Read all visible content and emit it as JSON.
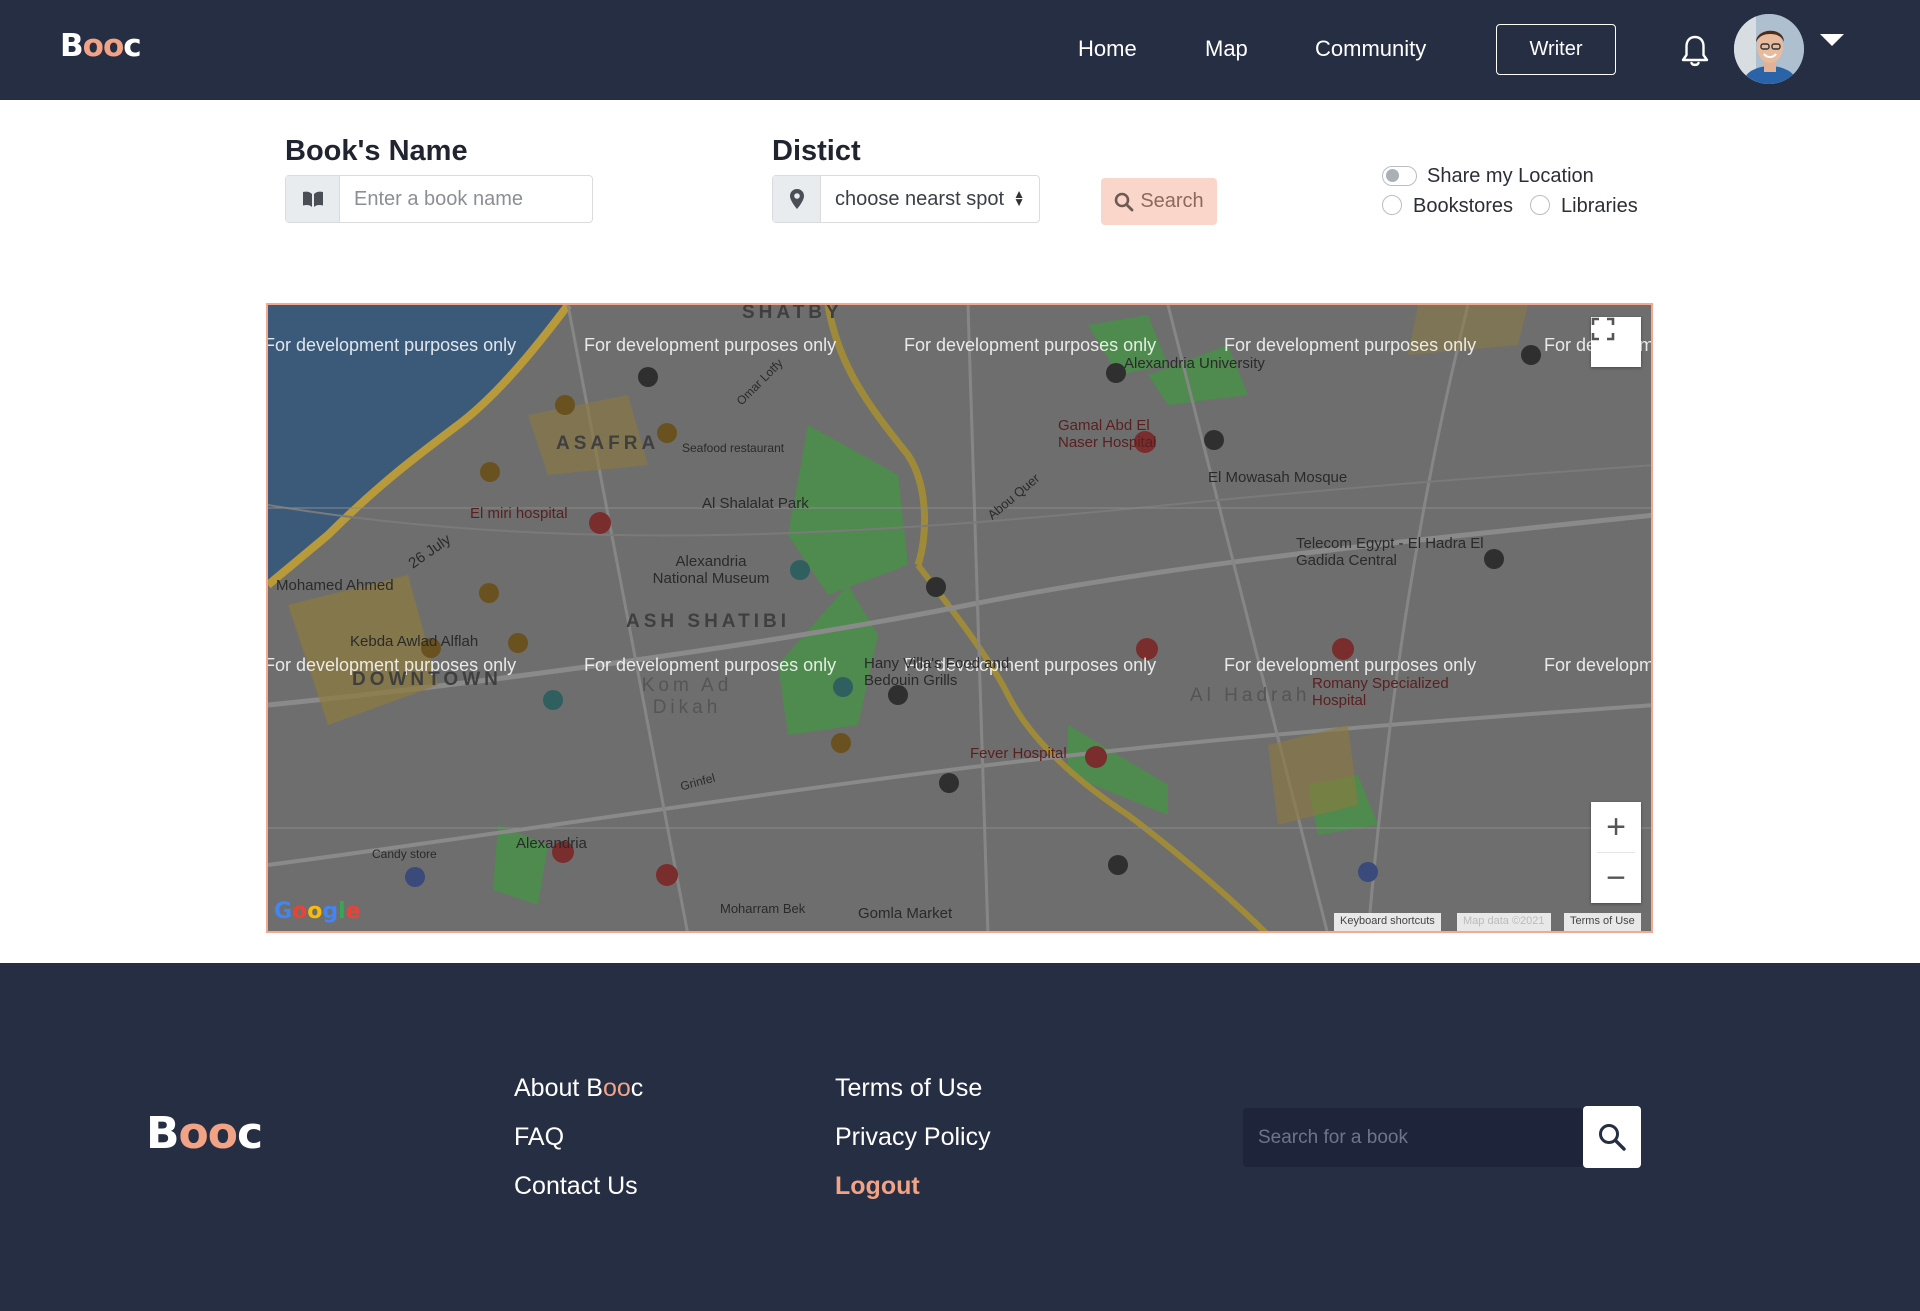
{
  "brand": {
    "logo_prefix": "B",
    "logo_oo": "oo",
    "logo_suffix": "c"
  },
  "nav": {
    "home": "Home",
    "map": "Map",
    "community": "Community",
    "writer_button": "Writer",
    "icons": {
      "notifications": "bell-icon",
      "profile_menu": "caret-down-icon"
    }
  },
  "search_form": {
    "book_label": "Book's Name",
    "book_placeholder": "Enter a book name",
    "book_icon": "book-icon",
    "district_label": "Distict",
    "district_select_value": "choose nearst spot",
    "district_icon": "map-pin-icon",
    "search_button": "Search",
    "share_location": "Share my Location",
    "share_location_on": false,
    "option_bookstores": "Bookstores",
    "option_libraries": "Libraries"
  },
  "map": {
    "watermark": "For development purposes only",
    "places": {
      "shatby": "SHATBY",
      "asafra": "ASAFRA",
      "ash_shatibi": "ASH SHATIBI",
      "downtown": "DOWNTOWN",
      "kom_ad_dikah": "Kom Ad Dikah",
      "al_hadrah": "Al Hadrah",
      "alexandria_university": "Alexandria University",
      "gamal_hospital": "Gamal Abd El Naser Hospital",
      "el_mowasah_mosque": "El Mowasah Mosque",
      "el_miri_hospital": "El miri hospital",
      "al_shalalat_park": "Al Shalalat Park",
      "national_museum": "Alexandria National Museum",
      "telecom_egypt": "Telecom Egypt - El Hadra El Gadida Central",
      "mohamed_ahmed": "Mohamed Ahmed",
      "kebda_awlad_alflah": "Kebda Awlad Alflah",
      "hany_villa": "Hany Villa's Food and Bedouin Grills",
      "fever_hospital": "Fever Hospital",
      "romany_hospital": "Romany Specialized Hospital",
      "alexandria": "Alexandria",
      "gomla_market": "Gomla Market",
      "moharram_bek": "Moharram Bek",
      "seafood_restaurant": "Seafood restaurant",
      "candy_store": "Candy store",
      "grinfel": "Grinfel",
      "road_26_july": "26 July",
      "abou_quer": "Abou Quer",
      "omar_lotfy": "Omar Lotfy"
    },
    "controls": {
      "fullscreen_icon": "fullscreen-icon",
      "zoom_in": "+",
      "zoom_out": "−"
    },
    "attribution": {
      "keyboard_shortcuts": "Keyboard shortcuts",
      "map_data": "Map data ©2021",
      "terms": "Terms of Use",
      "google": "Google"
    }
  },
  "footer": {
    "about_prefix": "About B",
    "about_oo": "oo",
    "about_suffix": "c",
    "faq": "FAQ",
    "contact": "Contact Us",
    "terms": "Terms of Use",
    "privacy": "Privacy Policy",
    "logout": "Logout",
    "search_placeholder": "Search for a book",
    "search_icon": "search-icon"
  },
  "colors": {
    "navy": "#262e44",
    "accent": "#f2a285",
    "search_button_bg": "#f9d6c9"
  }
}
